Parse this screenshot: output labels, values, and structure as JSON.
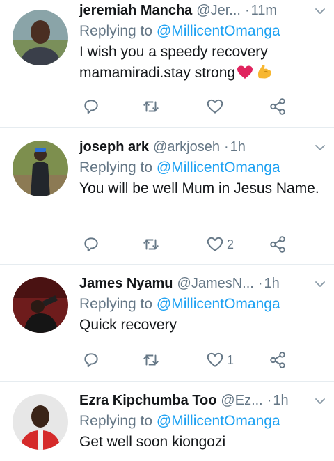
{
  "tweets": [
    {
      "name": "jeremiah Mancha",
      "handle": "@Jer...",
      "dot": "·",
      "time": "11m",
      "replying_prefix": "Replying to",
      "replying_to": "@MillicentOmanga",
      "text": "I wish you a speedy recovery mamamiradi.stay strong",
      "emojis": [
        "heart-emoji",
        "muscle-emoji"
      ],
      "like_count": ""
    },
    {
      "name": "joseph ark",
      "handle": "@arkjoseh",
      "dot": "·",
      "time": "1h",
      "replying_prefix": "Replying to",
      "replying_to": "@MillicentOmanga",
      "text": "You will be well Mum in Jesus Name.",
      "like_count": "2"
    },
    {
      "name": "James Nyamu",
      "handle": "@JamesN...",
      "dot": "·",
      "time": "1h",
      "replying_prefix": "Replying to",
      "replying_to": "@MillicentOmanga",
      "text": "Quick recovery",
      "like_count": "1"
    },
    {
      "name": "Ezra Kipchumba Too",
      "handle": "@Ez...",
      "dot": "·",
      "time": "1h",
      "replying_prefix": "Replying to",
      "replying_to": "@MillicentOmanga",
      "text": "Get well soon kiongozi",
      "like_count": ""
    }
  ],
  "icons": {
    "reply": "reply-icon",
    "retweet": "retweet-icon",
    "like": "like-icon",
    "share": "share-icon",
    "caret": "chevron-down-icon"
  },
  "colors": {
    "link": "#1da1f2",
    "muted": "#657786",
    "text": "#14171a",
    "divider": "#e6ecf0",
    "heart": "#e0245e"
  }
}
